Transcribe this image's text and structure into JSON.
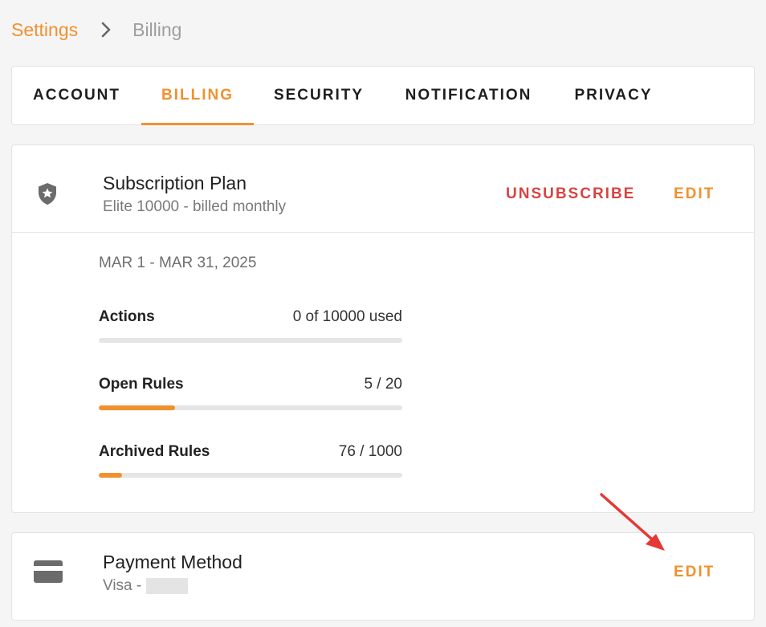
{
  "breadcrumb": {
    "root": "Settings",
    "current": "Billing",
    "separator_icon": "chevron-right-icon"
  },
  "tabs": [
    {
      "label": "ACCOUNT",
      "active": false
    },
    {
      "label": "BILLING",
      "active": true
    },
    {
      "label": "SECURITY",
      "active": false
    },
    {
      "label": "NOTIFICATION",
      "active": false
    },
    {
      "label": "PRIVACY",
      "active": false
    }
  ],
  "subscription": {
    "icon": "shield-star-icon",
    "title": "Subscription Plan",
    "plan": "Elite 10000 - billed monthly",
    "unsubscribe_label": "UNSUBSCRIBE",
    "edit_label": "EDIT",
    "period": "MAR 1 - MAR 31, 2025",
    "usage": [
      {
        "label": "Actions",
        "value": "0 of 10000 used",
        "used": 0,
        "limit": 10000
      },
      {
        "label": "Open Rules",
        "value": "5 / 20",
        "used": 5,
        "limit": 20
      },
      {
        "label": "Archived Rules",
        "value": "76 / 1000",
        "used": 76,
        "limit": 1000
      }
    ]
  },
  "payment": {
    "icon": "credit-card-icon",
    "title": "Payment Method",
    "card_prefix": "Visa -",
    "edit_label": "EDIT"
  },
  "annotation": {
    "icon": "red-arrow-icon"
  },
  "colors": {
    "accent": "#f0912f",
    "danger": "#d64541",
    "annotation": "#e53935"
  }
}
